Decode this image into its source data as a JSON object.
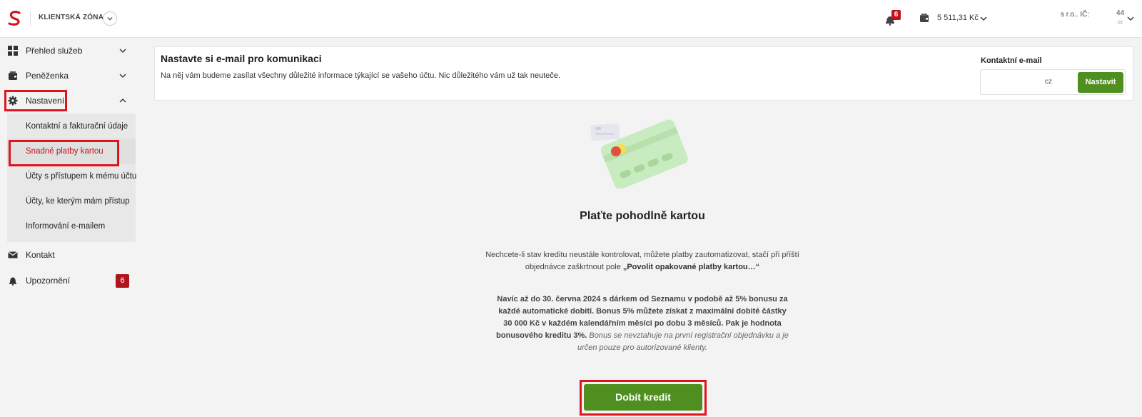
{
  "header": {
    "zone_title": "KLIENTSKÁ ZÓNA",
    "notification_count": "6",
    "balance": "5 511,31 Kč",
    "company": "s r.o.. IČ:",
    "account_number": "44",
    "account_domain": "cz"
  },
  "sidebar": {
    "items": [
      {
        "label": "Přehled služeb",
        "icon": "dashboard-icon"
      },
      {
        "label": "Peněženka",
        "icon": "wallet-icon"
      },
      {
        "label": "Nastavení",
        "icon": "gear-icon"
      },
      {
        "label": "Kontakt",
        "icon": "envelope-icon"
      },
      {
        "label": "Upozornění",
        "icon": "bell-icon",
        "badge": "6"
      }
    ],
    "subitems": [
      {
        "label": "Kontaktní a fakturační údaje"
      },
      {
        "label": "Snadné platby kartou"
      },
      {
        "label": "Účty s přístupem k mému účtu"
      },
      {
        "label": "Účty, ke kterým mám přístup"
      },
      {
        "label": "Informování e-mailem"
      }
    ]
  },
  "email_panel": {
    "title": "Nastavte si e-mail pro komunikaci",
    "description": "Na něj vám budeme zasílat všechny důležité informace týkající se vašeho účtu. Nic důležitého vám už tak neuteče.",
    "contact_label": "Kontaktní e-mail",
    "email_value": "cz",
    "set_button": "Nastavit"
  },
  "main": {
    "title": "Plaťte pohodlně kartou",
    "para1_text": "Nechcete-li stav kreditu neustále kontrolovat, můžete platby zautomatizovat, stačí při příští objednávce zaškrtnout pole ",
    "para1_bold": "„Povolit opakované platby kartou…“",
    "para2_bold": "Navíc až do 30. června 2024 s dárkem od Seznamu v podobě až 5% bonusu za každé automatické dobití. Bonus 5% můžete získat z maximální dobité částky 30 000 Kč v každém kalendářním měsíci po dobu 3 měsíců. Pak je hodnota bonusového kreditu 3%.",
    "para2_italic": "Bonus se nevztahuje na první registrační objednávku a je určen pouze pro autorizované klienty.",
    "topup_button": "Dobít kredit"
  },
  "colors": {
    "accent_green": "#4f8f1f",
    "brand_red": "#c0141d",
    "highlight_red": "#e0141d"
  }
}
